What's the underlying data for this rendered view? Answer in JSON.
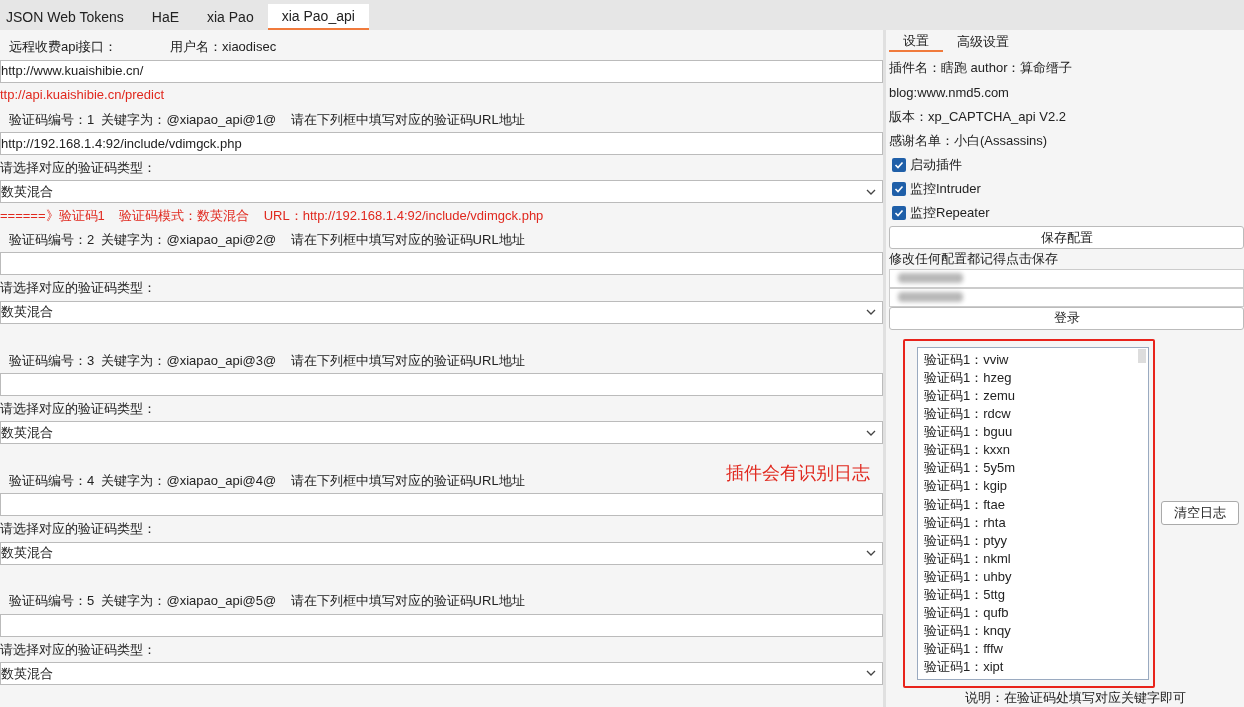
{
  "tabs": [
    {
      "label": "JSON Web Tokens",
      "selected": false
    },
    {
      "label": "HaE",
      "selected": false
    },
    {
      "label": "xia Pao",
      "selected": false
    },
    {
      "label": "xia Pao_api",
      "selected": true
    }
  ],
  "api": {
    "label": "远程收费api接口：",
    "username": "用户名：xiaodisec",
    "url": "http://www.kuaishibie.cn/",
    "endpoint": "ttp://api.kuaishibie.cn/predict"
  },
  "captchas": [
    {
      "header": "验证码编号：1  关键字为：@xiapao_api@1@    请在下列框中填写对应的验证码URL地址",
      "url": "http://192.168.1.4:92/include/vdimgck.php",
      "type_label": "请选择对应的验证码类型：",
      "type": "数英混合",
      "log": "======》验证码1    验证码模式：数英混合    URL：http://192.168.1.4:92/include/vdimgck.php"
    },
    {
      "header": "验证码编号：2  关键字为：@xiapao_api@2@    请在下列框中填写对应的验证码URL地址",
      "type_label": "请选择对应的验证码类型：",
      "type": "数英混合"
    },
    {
      "header": "验证码编号：3  关键字为：@xiapao_api@3@    请在下列框中填写对应的验证码URL地址",
      "type_label": "请选择对应的验证码类型：",
      "type": "数英混合"
    },
    {
      "header": "验证码编号：4  关键字为：@xiapao_api@4@    请在下列框中填写对应的验证码URL地址",
      "type_label": "请选择对应的验证码类型：",
      "type": "数英混合"
    },
    {
      "header": "验证码编号：5  关键字为：@xiapao_api@5@    请在下列框中填写对应的验证码URL地址",
      "type_label": "请选择对应的验证码类型：",
      "type": "数英混合"
    }
  ],
  "settings": {
    "tabs": [
      {
        "label": "设置",
        "selected": true
      },
      {
        "label": "高级设置",
        "selected": false
      }
    ],
    "info": [
      "插件名：瞎跑 author：算命缙子",
      "blog:www.nmd5.com",
      "版本：xp_CAPTCHA_api V2.2",
      "感谢名单：小白(Assassins)"
    ],
    "checkboxes": [
      {
        "label": "启动插件",
        "checked": true
      },
      {
        "label": "监控Intruder",
        "checked": true
      },
      {
        "label": "监控Repeater",
        "checked": true
      }
    ],
    "save_button": "保存配置",
    "hint": "修改任何配置都记得点击保存",
    "fields": [
      {
        "blurred": true
      },
      {
        "blurred": true
      }
    ],
    "login_button": "登录",
    "log": [
      "验证码1：vviw",
      "验证码1：hzeg",
      "验证码1：zemu",
      "验证码1：rdcw",
      "验证码1：bguu",
      "验证码1：kxxn",
      "验证码1：5y5m",
      "验证码1：kgip",
      "验证码1：ftae",
      "验证码1：rhta",
      "验证码1：ptyy",
      "验证码1：nkml",
      "验证码1：uhby",
      "验证码1：5ttg",
      "验证码1：qufb",
      "验证码1：knqy",
      "验证码1：fffw",
      "验证码1：xipt"
    ],
    "clear_button": "清空日志",
    "note": "说明：在验证码处填写对应关键字即可"
  },
  "annotation": {
    "text": "插件会有识别日志"
  }
}
